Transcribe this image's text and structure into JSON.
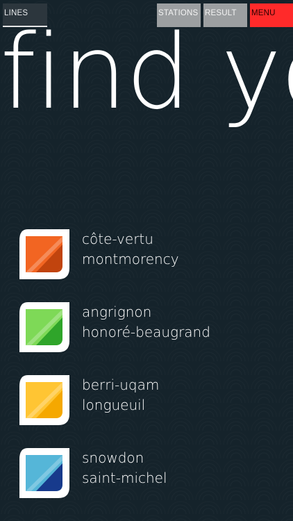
{
  "tabs": {
    "lines": "LINES",
    "stations": "STATIONS",
    "result": "RESULT",
    "menu": "MENU"
  },
  "hero": {
    "text": "find you"
  },
  "lines": [
    {
      "from": "côte-vertu",
      "to": "montmorency",
      "color": "#f26522",
      "color_dark": "#c1440e",
      "icon": "orange-line-icon"
    },
    {
      "from": "angrignon",
      "to": "honoré-beaugrand",
      "color": "#7ed957",
      "color_dark": "#2fa52a",
      "icon": "green-line-icon"
    },
    {
      "from": "berri-uqam",
      "to": "longueuil",
      "color": "#ffc533",
      "color_dark": "#f5a800",
      "icon": "yellow-line-icon"
    },
    {
      "from": "snowdon",
      "to": "saint-michel",
      "color": "#55b6d8",
      "color_dark": "#173a8c",
      "icon": "blue-line-icon"
    }
  ],
  "colors": {
    "background": "#15232b",
    "menu": "#ff2a2a",
    "tab_inactive": "#9c9fa1"
  }
}
